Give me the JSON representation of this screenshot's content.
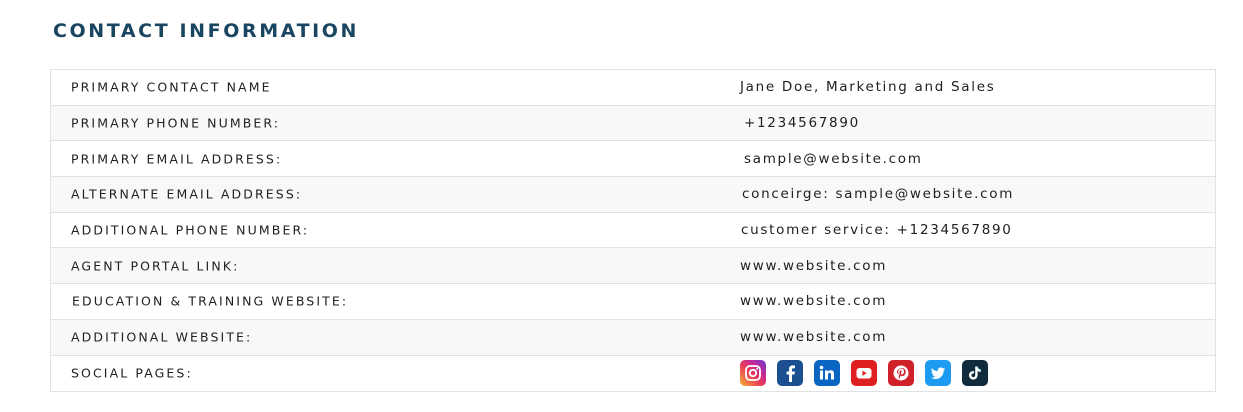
{
  "section": {
    "title": "CONTACT INFORMATION"
  },
  "rows": [
    {
      "label": "PRIMARY CONTACT NAME",
      "value": "Jane Doe, Marketing and Sales"
    },
    {
      "label": "PRIMARY PHONE NUMBER:",
      "value": "+1234567890"
    },
    {
      "label": "PRIMARY EMAIL ADDRESS:",
      "value": "sample@website.com"
    },
    {
      "label": "ALTERNATE EMAIL ADDRESS:",
      "value": "conceirge: sample@website.com"
    },
    {
      "label": "ADDITIONAL PHONE NUMBER:",
      "value": "customer service: +1234567890"
    },
    {
      "label": "AGENT PORTAL LINK:",
      "value": "www.website.com"
    },
    {
      "label": "EDUCATION & TRAINING WEBSITE:",
      "value": "www.website.com"
    },
    {
      "label": "ADDITIONAL WEBSITE:",
      "value": "www.website.com"
    },
    {
      "label": "SOCIAL PAGES:",
      "value": ""
    }
  ],
  "social_icons": [
    {
      "name": "instagram-icon",
      "color": "#d6287f"
    },
    {
      "name": "facebook-icon",
      "color": "#1b4f8f"
    },
    {
      "name": "linkedin-icon",
      "color": "#0a66c2"
    },
    {
      "name": "youtube-icon",
      "color": "#e02020"
    },
    {
      "name": "pinterest-icon",
      "color": "#d0202a"
    },
    {
      "name": "twitter-icon",
      "color": "#1d9bf0"
    },
    {
      "name": "tiktok-icon",
      "color": "#0f2b3c"
    }
  ],
  "colors": {
    "title": "#1a4560",
    "border": "#e2e2e2",
    "alt_row": "#f8f8f8"
  }
}
